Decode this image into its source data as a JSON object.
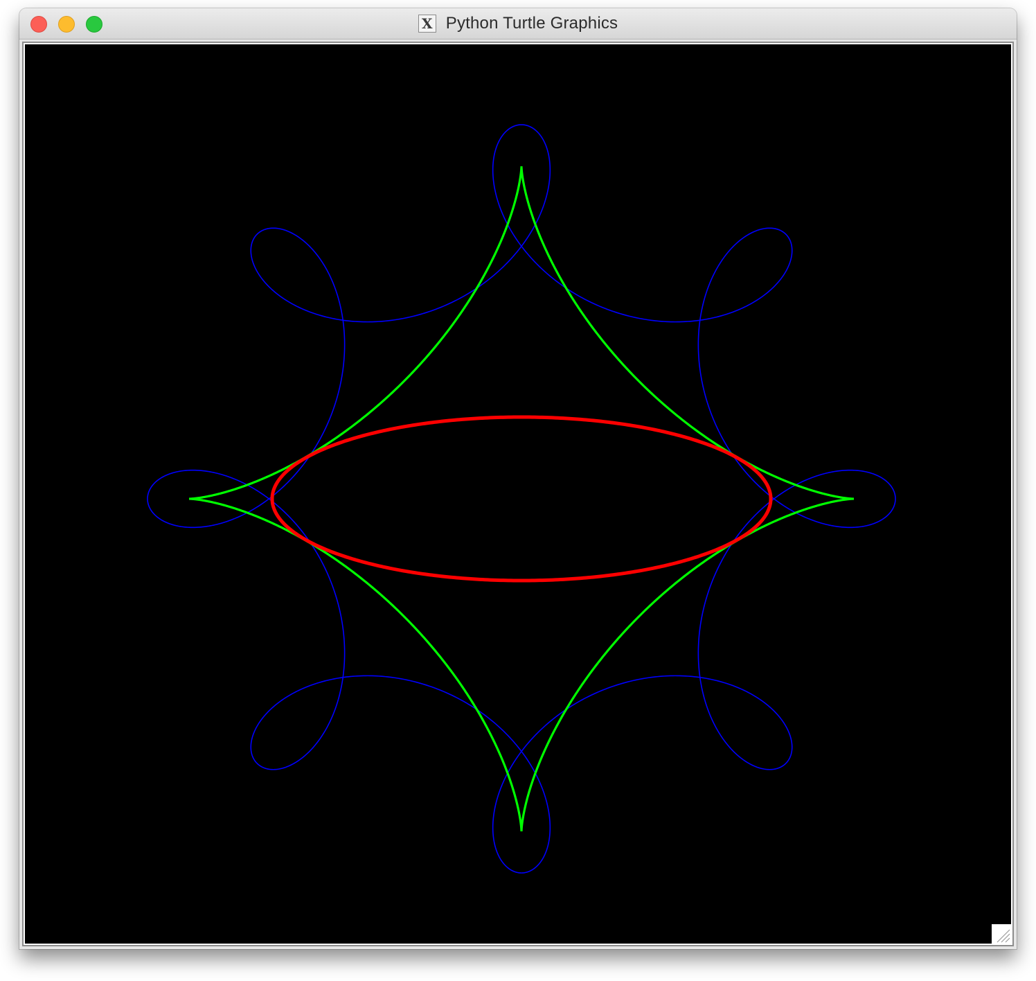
{
  "window": {
    "title": "Python Turtle Graphics",
    "app_icon_glyph": "X",
    "controls": [
      "close",
      "minimize",
      "zoom"
    ]
  },
  "canvas": {
    "background": "#000000",
    "curves": [
      {
        "name": "loops",
        "color": "#0000ff"
      },
      {
        "name": "astroid",
        "color": "#00ff00"
      },
      {
        "name": "ellipse",
        "color": "#ff0000"
      }
    ]
  },
  "icons": {
    "close": "close-button-icon",
    "minimize": "minimize-button-icon",
    "zoom": "zoom-button-icon",
    "app": "x11-app-icon",
    "resize": "resize-grip-icon"
  }
}
